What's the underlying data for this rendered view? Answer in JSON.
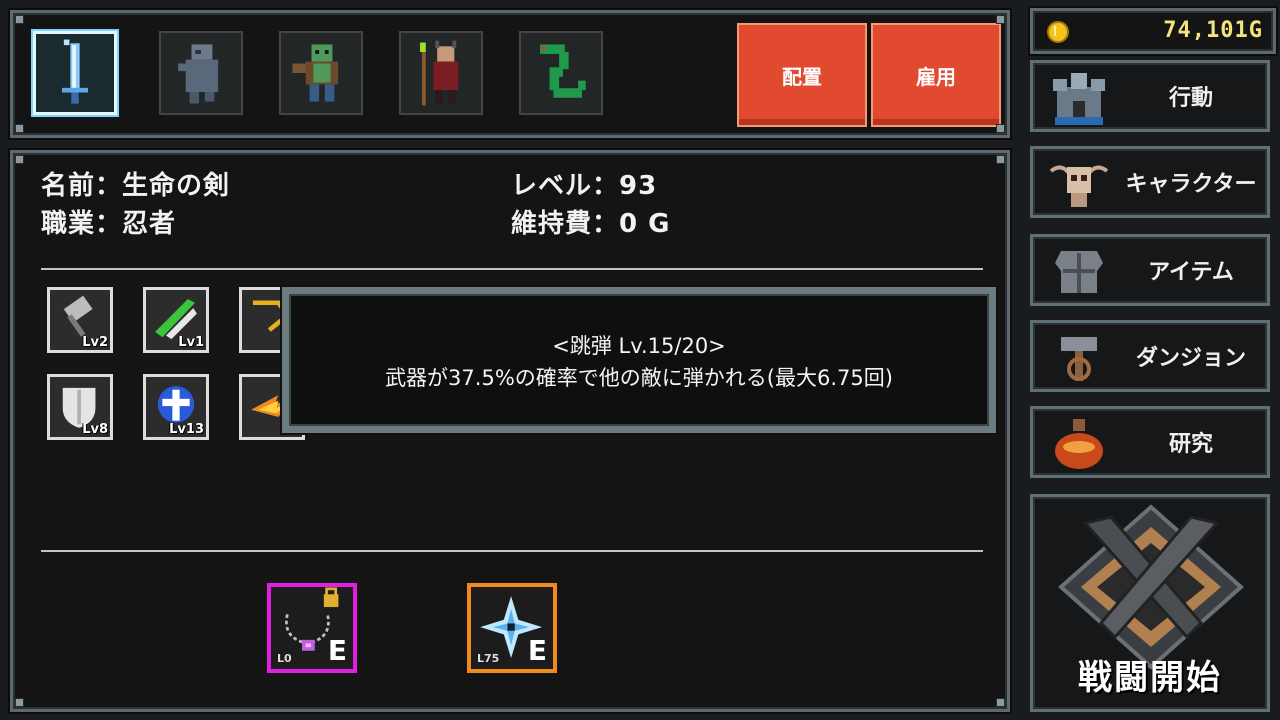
{
  "party": {
    "slots": [
      {
        "name": "sword-character",
        "selected": true
      },
      {
        "name": "ghost-character",
        "selected": false
      },
      {
        "name": "orc-character",
        "selected": false
      },
      {
        "name": "mage-character",
        "selected": false
      },
      {
        "name": "serpent-character",
        "selected": false
      }
    ],
    "place_label": "配置",
    "hire_label": "雇用"
  },
  "character": {
    "name_line": "名前：生命の剣",
    "job_line": "職業：忍者",
    "level_line": "レベル：93",
    "upkeep_line": "維持費：0 G"
  },
  "skills": {
    "row1": [
      {
        "icon": "hammer-skill-icon",
        "level": "Lv2"
      },
      {
        "icon": "green-blade-skill-icon",
        "level": "Lv1"
      },
      {
        "icon": "bounce-skill-icon",
        "level": "Lv"
      }
    ],
    "row2": [
      {
        "icon": "shield-skill-icon",
        "level": "Lv8"
      },
      {
        "icon": "holy-shield-skill-icon",
        "level": "Lv13"
      },
      {
        "icon": "fire-skill-icon",
        "level": "Lv"
      }
    ]
  },
  "tooltip": {
    "title": "<跳弾 Lv.15/20>",
    "description": "武器が37.5%の確率で他の敵に弾かれる(最大6.75回)"
  },
  "equipment": [
    {
      "icon": "necklace-icon",
      "level": "L0",
      "flag": "E",
      "rarity_color": "#e020e0",
      "locked": true
    },
    {
      "icon": "shuriken-icon",
      "level": "L75",
      "flag": "E",
      "rarity_color": "#f08a1c",
      "locked": false
    }
  ],
  "gold": {
    "value": "74,101G"
  },
  "menu": {
    "action": "行動",
    "character": "キャラクター",
    "item": "アイテム",
    "dungeon": "ダンジョン",
    "research": "研究"
  },
  "battle_label": "戦闘開始",
  "colors": {
    "accent_red": "#e24a30",
    "gold": "#f5e27a",
    "frame": "#5a6a70"
  }
}
